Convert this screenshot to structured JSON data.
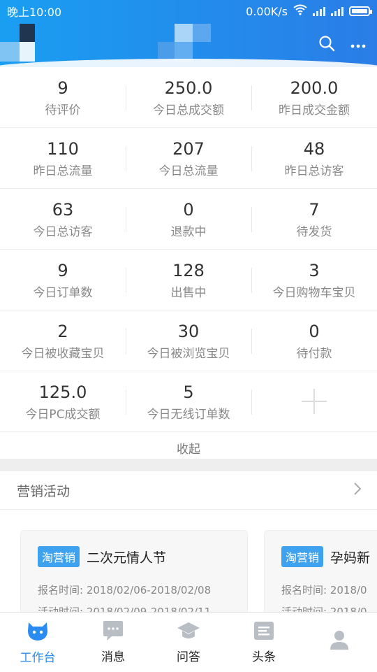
{
  "statusbar": {
    "time": "晚上10:00",
    "network_speed": "0.00K/s"
  },
  "header": {
    "search_icon": "search-icon",
    "more_icon": "more-dots-icon",
    "colors": {
      "start": "#1a9ef2",
      "end": "#2a7de6"
    }
  },
  "stats": {
    "rows": [
      [
        {
          "value": "9",
          "label": "待评价"
        },
        {
          "value": "250.0",
          "label": "今日总成交额"
        },
        {
          "value": "200.0",
          "label": "昨日成交金额"
        }
      ],
      [
        {
          "value": "110",
          "label": "昨日总流量"
        },
        {
          "value": "207",
          "label": "今日总流量"
        },
        {
          "value": "48",
          "label": "昨日总访客"
        }
      ],
      [
        {
          "value": "63",
          "label": "今日总访客"
        },
        {
          "value": "0",
          "label": "退款中"
        },
        {
          "value": "7",
          "label": "待发货"
        }
      ],
      [
        {
          "value": "9",
          "label": "今日订单数"
        },
        {
          "value": "128",
          "label": "出售中"
        },
        {
          "value": "3",
          "label": "今日购物车宝贝"
        }
      ],
      [
        {
          "value": "2",
          "label": "今日被收藏宝贝"
        },
        {
          "value": "30",
          "label": "今日被浏览宝贝"
        },
        {
          "value": "0",
          "label": "待付款"
        }
      ],
      [
        {
          "value": "125.0",
          "label": "今日PC成交额"
        },
        {
          "value": "5",
          "label": "今日无线订单数"
        }
      ]
    ],
    "collapse_label": "收起"
  },
  "marketing": {
    "title": "营销活动",
    "cards": [
      {
        "tag": "淘营销",
        "name": "二次元情人节",
        "signup": "报名时间: 2018/02/06-2018/02/08",
        "activity": "活动时间: 2018/02/09-2018/02/11"
      },
      {
        "tag": "淘营销",
        "name": "孕妈新",
        "signup": "报名时间: 2018/0",
        "activity": "活动时间: 2018/0"
      }
    ]
  },
  "tabbar": {
    "active_color": "#2a8cf0",
    "tabs": [
      {
        "label": "工作台",
        "icon": "workbench-mascot-icon"
      },
      {
        "label": "消息",
        "icon": "message-icon"
      },
      {
        "label": "问答",
        "icon": "graduation-cap-icon"
      },
      {
        "label": "头条",
        "icon": "news-icon"
      },
      {
        "label": "",
        "icon": "profile-icon"
      }
    ]
  }
}
